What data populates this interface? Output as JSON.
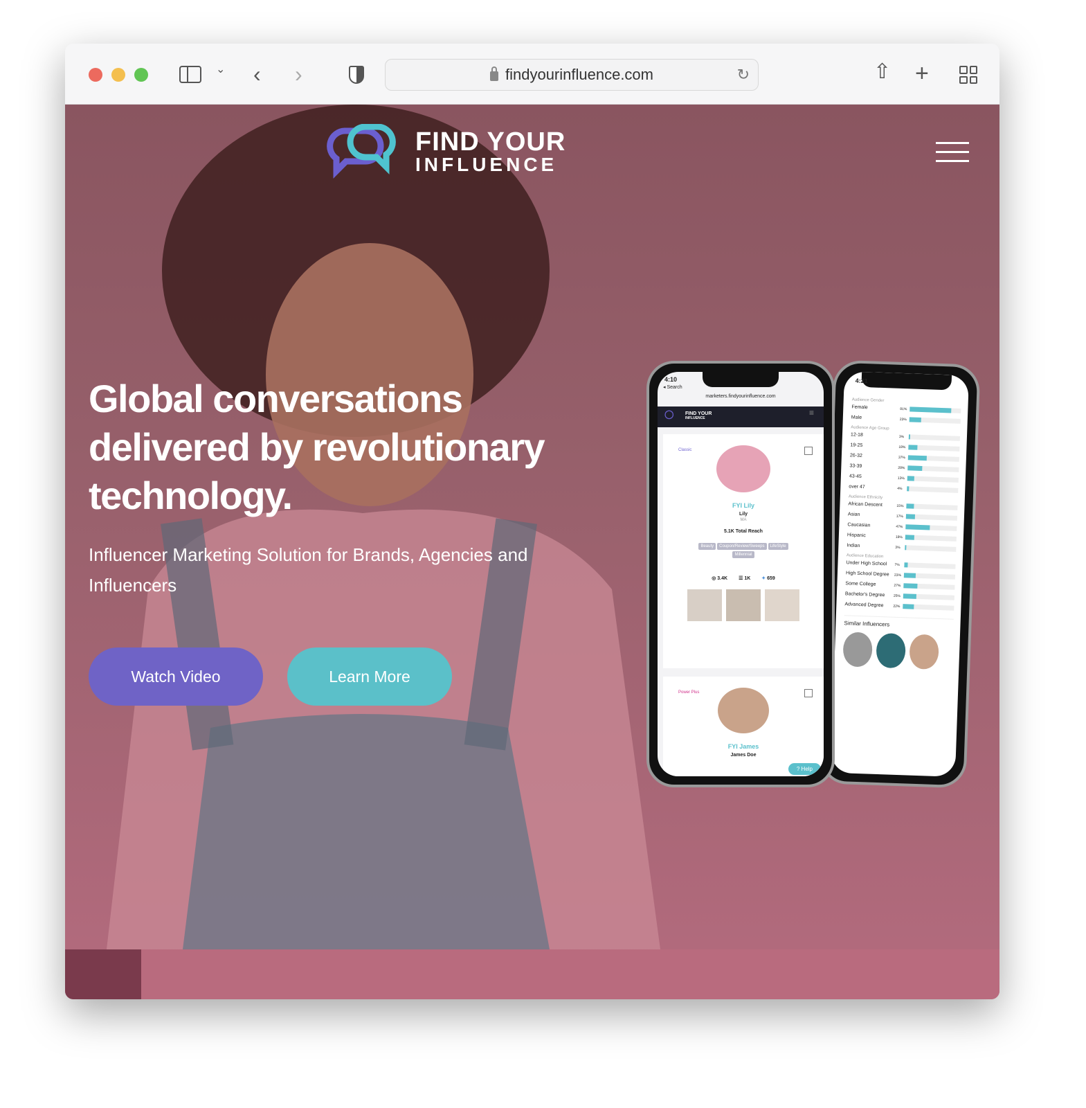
{
  "browser": {
    "url": "findyourinfluence.com",
    "traffic_lights": [
      "#ec6a5e",
      "#f4bf4f",
      "#61c554"
    ]
  },
  "nav": {
    "logo_line1": "FIND YOUR",
    "logo_line2": "INFLUENCE",
    "menu_icon": "hamburger-icon"
  },
  "hero": {
    "headline": "Global conversations delivered by revolutionary technology.",
    "subheadline": "Influencer Marketing Solution for Brands, Agencies and Influencers",
    "watch_video": "Watch Video",
    "learn_more": "Learn More",
    "colors": {
      "watch_video": "#6f63c6",
      "learn_more": "#5bc0c9",
      "logo_purple": "#6b5fcf",
      "logo_teal": "#4fc3cf"
    }
  },
  "phone_left": {
    "time": "4:10",
    "back": "◂ Search",
    "url": "marketers.findyourinfluence.com",
    "logo1": "FIND YOUR",
    "logo2": "INFLUENCE",
    "card1": {
      "tier": "Classic",
      "name": "FYI Lily",
      "handle": "Lily",
      "location": "MA",
      "reach": "5.1K Total Reach",
      "tags": [
        "Beauty",
        "Coupon/Review/Sweeps",
        "LifeStyle",
        "Millennial"
      ],
      "instagram": "3.4K",
      "rss": "1K",
      "twitter": "659"
    },
    "card2": {
      "tier": "Power Plus",
      "name": "FYI James",
      "handle": "James Doe"
    },
    "help": "Help"
  },
  "phone_right": {
    "time": "4:21",
    "sections": [
      {
        "title": "Audience Gender",
        "rows": [
          {
            "label": "Female",
            "value": 81
          },
          {
            "label": "Male",
            "value": 23
          }
        ]
      },
      {
        "title": "Audience Age Group",
        "rows": [
          {
            "label": "12-18",
            "value": 3
          },
          {
            "label": "19-25",
            "value": 18
          },
          {
            "label": "26-32",
            "value": 37
          },
          {
            "label": "33-39",
            "value": 28
          },
          {
            "label": "43-45",
            "value": 13
          },
          {
            "label": "over 47",
            "value": 4
          }
        ]
      },
      {
        "title": "Audience Ethnicity",
        "rows": [
          {
            "label": "African Descent",
            "value": 15
          },
          {
            "label": "Asian",
            "value": 17
          },
          {
            "label": "Caucasian",
            "value": 47
          },
          {
            "label": "Hispanic",
            "value": 18
          },
          {
            "label": "Indian",
            "value": 3
          }
        ]
      },
      {
        "title": "Audience Education",
        "rows": [
          {
            "label": "Under High School",
            "value": 7
          },
          {
            "label": "High School Degree",
            "value": 23
          },
          {
            "label": "Some College",
            "value": 27
          },
          {
            "label": "Bachelor's Degree",
            "value": 25
          },
          {
            "label": "Advanced Degree",
            "value": 22
          }
        ]
      }
    ],
    "similar": "Similar Influencers"
  }
}
